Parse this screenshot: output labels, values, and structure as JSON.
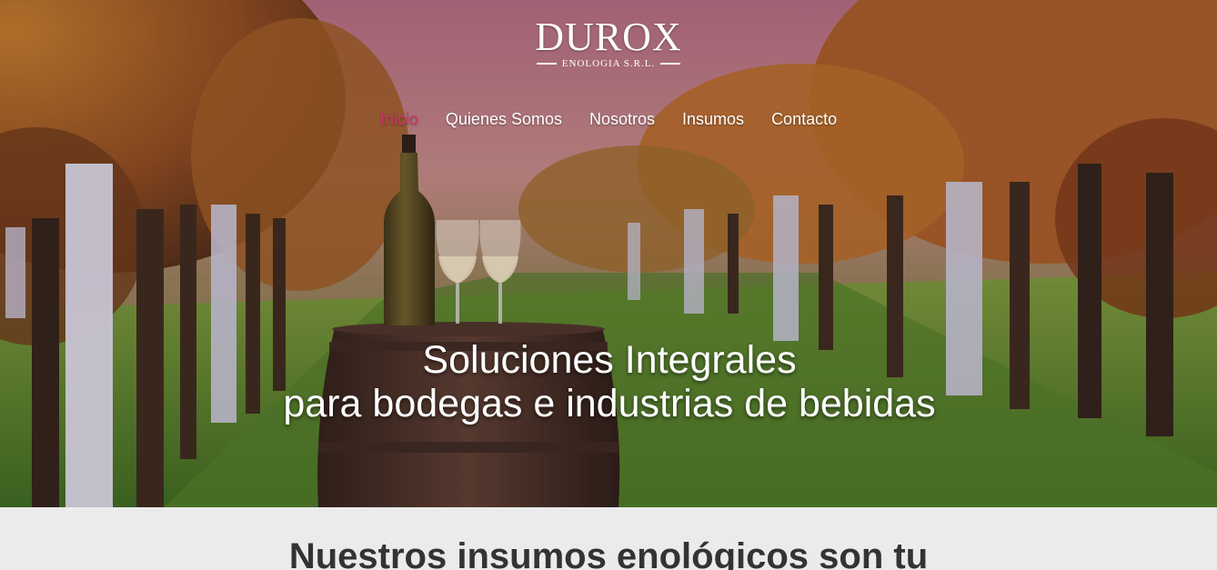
{
  "brand": {
    "name": "DUROX",
    "subtitle": "ENOLOGIA S.R.L."
  },
  "nav": {
    "items": [
      {
        "label": "Inicio",
        "active": true
      },
      {
        "label": "Quienes Somos",
        "active": false
      },
      {
        "label": "Nosotros",
        "active": false
      },
      {
        "label": "Insumos",
        "active": false
      },
      {
        "label": "Contacto",
        "active": false
      }
    ]
  },
  "hero": {
    "headline_line1": "Soluciones Integrales",
    "headline_line2": "para bodegas e industrias de bebidas"
  },
  "section": {
    "heading": "Nuestros insumos enológicos son tu"
  },
  "colors": {
    "accent": "#d1356f",
    "nav_text": "#ffffff",
    "section_bg": "#ebebeb",
    "heading_text": "#333333"
  }
}
